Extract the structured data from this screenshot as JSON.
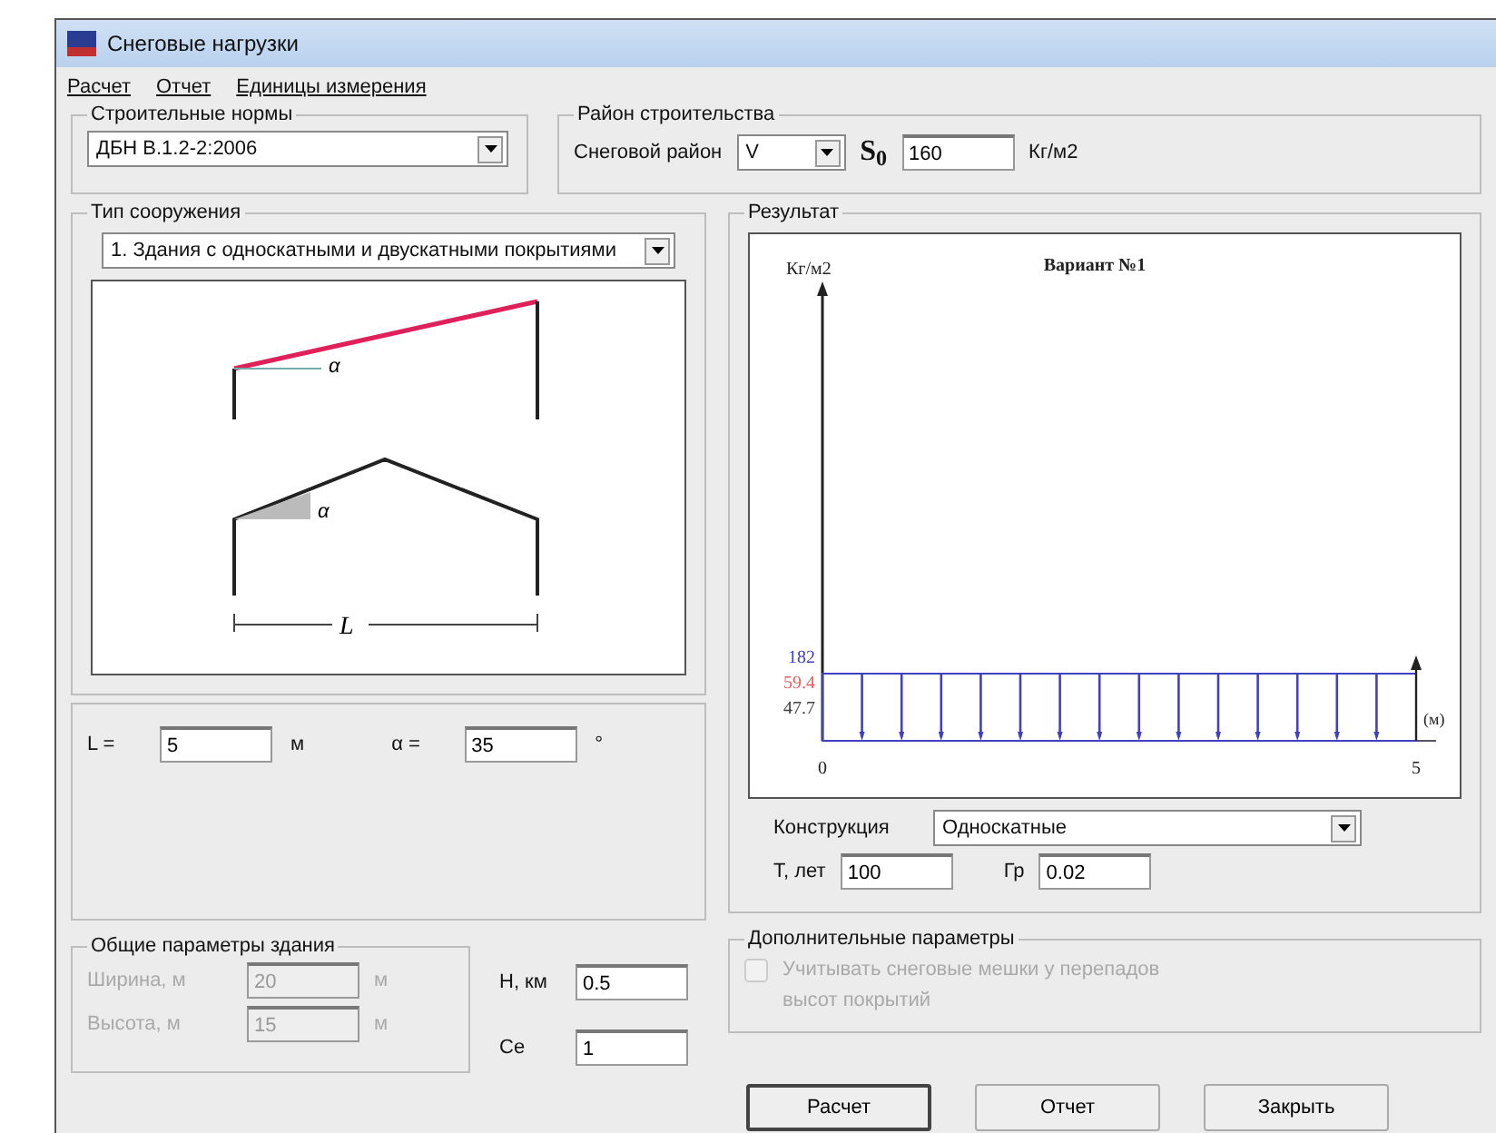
{
  "window": {
    "title": "Снеговые нагрузки"
  },
  "menu": [
    {
      "label": "Расчет"
    },
    {
      "label": "Отчет"
    },
    {
      "label": "Единицы измерения"
    }
  ],
  "norms": {
    "legend": "Строительные нормы",
    "value": "ДБН В.1.2-2:2006"
  },
  "region": {
    "legend": "Район строительства",
    "label": "Снеговой район",
    "value": "V",
    "symbol": "S$_{0}$",
    "load": "160",
    "unit": "Кг/м2"
  },
  "structure": {
    "legend": "Тип сооружения",
    "value": "1. Здания с односкатными и двускатными покрытиями",
    "slope_labels": [
      "α",
      "α"
    ],
    "span_label": "L"
  },
  "geometry": [
    {
      "label": "L =",
      "value": "5",
      "unit": "м"
    },
    {
      "label": "α =",
      "value": "35",
      "unit": "°"
    }
  ],
  "building": {
    "legend": "Общие параметры здания",
    "disabled": true,
    "fields": [
      {
        "label": "Ширина, м",
        "value": "20",
        "unit": "м"
      },
      {
        "label": "Высота, м",
        "value": "15",
        "unit": "м"
      }
    ]
  },
  "site": [
    {
      "label": "H, км",
      "value": "0.5"
    },
    {
      "label": "Ce",
      "value": "1"
    }
  ],
  "result": {
    "legend": "Результат",
    "chart": {
      "y_unit": "Кг/м2",
      "title": "Вариант №1",
      "labels": [
        {
          "text": "182",
          "color": "#4040c0"
        },
        {
          "text": "59.4",
          "color": "#e06060"
        },
        {
          "text": "47.7",
          "color": "#404040"
        }
      ],
      "x_start": "0",
      "x_end": "5",
      "x_unit": "(м)"
    },
    "construction_label": "Конструкция",
    "construction": "Односкатные",
    "period_label": "T, лет",
    "period": "100",
    "gamma_label": "Гр",
    "gamma": "0.02"
  },
  "extra": {
    "legend": "Дополнительные параметры",
    "checked": false,
    "disabled": true,
    "text": "Учитывать снеговые мешки у перепадов высот покрытий"
  },
  "buttons": [
    {
      "label": "Расчет",
      "default": true
    },
    {
      "label": "Отчет",
      "default": false
    },
    {
      "label": "Закрыть",
      "default": false
    }
  ]
}
